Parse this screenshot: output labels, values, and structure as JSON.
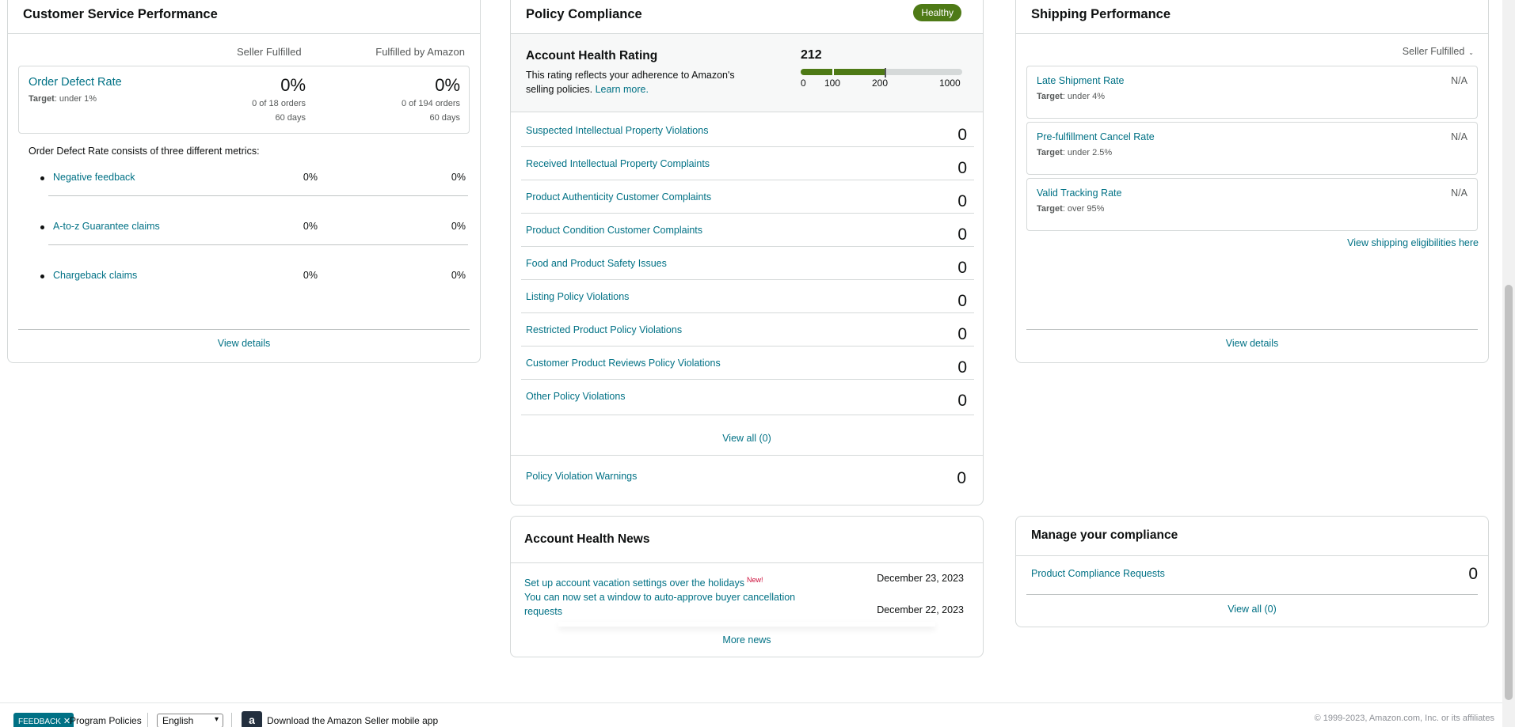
{
  "customer_service": {
    "title": "Customer Service Performance",
    "col_seller": "Seller Fulfilled",
    "col_fba": "Fulfilled by Amazon",
    "odr": {
      "name": "Order Defect Rate",
      "target_label": "Target",
      "target_value": ": under 1%",
      "seller_pct": "0%",
      "seller_orders": "0 of 18 orders",
      "seller_days": "60 days",
      "fba_pct": "0%",
      "fba_orders": "0 of 194 orders",
      "fba_days": "60 days"
    },
    "consists_text": "Order Defect Rate consists of three different metrics:",
    "metrics": [
      {
        "label": "Negative feedback",
        "seller": "0%",
        "fba": "0%"
      },
      {
        "label": "A-to-z Guarantee claims",
        "seller": "0%",
        "fba": "0%"
      },
      {
        "label": "Chargeback claims",
        "seller": "0%",
        "fba": "0%"
      }
    ],
    "view_details": "View details"
  },
  "policy": {
    "title": "Policy Compliance",
    "badge": "Healthy",
    "badge_color": "#4e7a16",
    "ahr_title": "Account Health Rating",
    "ahr_desc": "This rating reflects your adherence to Amazon's selling policies.",
    "ahr_learn": "Learn more.",
    "ahr_score": "212",
    "ahr_score_value": 212,
    "scale_ticks": [
      "0",
      "100",
      "200",
      "1000"
    ],
    "rows": [
      {
        "label": "Suspected Intellectual Property Violations",
        "value": "0"
      },
      {
        "label": "Received Intellectual Property Complaints",
        "value": "0"
      },
      {
        "label": "Product Authenticity Customer Complaints",
        "value": "0"
      },
      {
        "label": "Product Condition Customer Complaints",
        "value": "0"
      },
      {
        "label": "Food and Product Safety Issues",
        "value": "0"
      },
      {
        "label": "Listing Policy Violations",
        "value": "0"
      },
      {
        "label": "Restricted Product Policy Violations",
        "value": "0"
      },
      {
        "label": "Customer Product Reviews Policy Violations",
        "value": "0"
      },
      {
        "label": "Other Policy Violations",
        "value": "0"
      }
    ],
    "view_all": "View all (0)",
    "warnings_label": "Policy Violation Warnings",
    "warnings_value": "0"
  },
  "news": {
    "title": "Account Health News",
    "items": [
      {
        "text": "Set up account vacation settings over the holidays",
        "new_tag": "New!",
        "date": "December 23, 2023"
      },
      {
        "text": "You can now set a window to auto-approve buyer cancellation requests",
        "date": "December 22, 2023"
      }
    ],
    "more": "More news"
  },
  "shipping": {
    "title": "Shipping Performance",
    "dropdown": "Seller Fulfilled",
    "metrics": [
      {
        "name": "Late Shipment Rate",
        "target_label": "Target",
        "target_value": ": under 4%",
        "value": "N/A"
      },
      {
        "name": "Pre-fulfillment Cancel Rate",
        "target_label": "Target",
        "target_value": ": under 2.5%",
        "value": "N/A"
      },
      {
        "name": "Valid Tracking Rate",
        "target_label": "Target",
        "target_value": ": over 95%",
        "value": "N/A"
      }
    ],
    "eligibilities": "View shipping eligibilities here",
    "view_details": "View details"
  },
  "compliance": {
    "title": "Manage your compliance",
    "row_label": "Product Compliance Requests",
    "row_value": "0",
    "view_all": "View all (0)"
  },
  "footer": {
    "feedback": "FEEDBACK",
    "program_policies": "Program Policies",
    "language": "English",
    "app_text": "Download the Amazon Seller mobile app",
    "copyright": "© 1999-2023, Amazon.com, Inc. or its affiliates"
  }
}
